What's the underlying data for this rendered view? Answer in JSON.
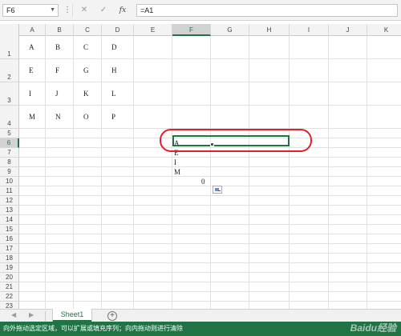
{
  "formula_bar": {
    "name_box": "F6",
    "dots": "⋮",
    "cancel": "✕",
    "enter": "✓",
    "fx": "fx",
    "formula": "=A1"
  },
  "columns": [
    "A",
    "B",
    "C",
    "D",
    "E",
    "F",
    "G",
    "H",
    "I",
    "J",
    "K"
  ],
  "selected_column": "F",
  "rows": [
    "1",
    "2",
    "3",
    "4",
    "5",
    "6",
    "7",
    "8",
    "9",
    "10",
    "11",
    "12",
    "13",
    "14",
    "15",
    "16",
    "17",
    "18",
    "19",
    "20",
    "21",
    "22",
    "23"
  ],
  "selected_row": "6",
  "cells": {
    "A1": "A",
    "B1": "B",
    "C1": "C",
    "D1": "D",
    "A2": "E",
    "B2": "F",
    "C2": "G",
    "D2": "H",
    "A3": "I",
    "B3": "J",
    "C3": "K",
    "D3": "L",
    "A4": "M",
    "B4": "N",
    "C4": "O",
    "D4": "P",
    "E6": "A",
    "E7": "E",
    "E8": "I",
    "E9": "M",
    "F10": "0"
  },
  "sheet_tabs": {
    "nav_prev": "◀",
    "nav_next": "▶",
    "active": "Sheet1",
    "add": "+"
  },
  "status_text": "向外拖动选定区域，可以扩展或填充序列；向内拖动则进行清除",
  "watermark": "Baidu经验",
  "colors": {
    "accent": "#217346",
    "annotation": "#e0202a"
  }
}
